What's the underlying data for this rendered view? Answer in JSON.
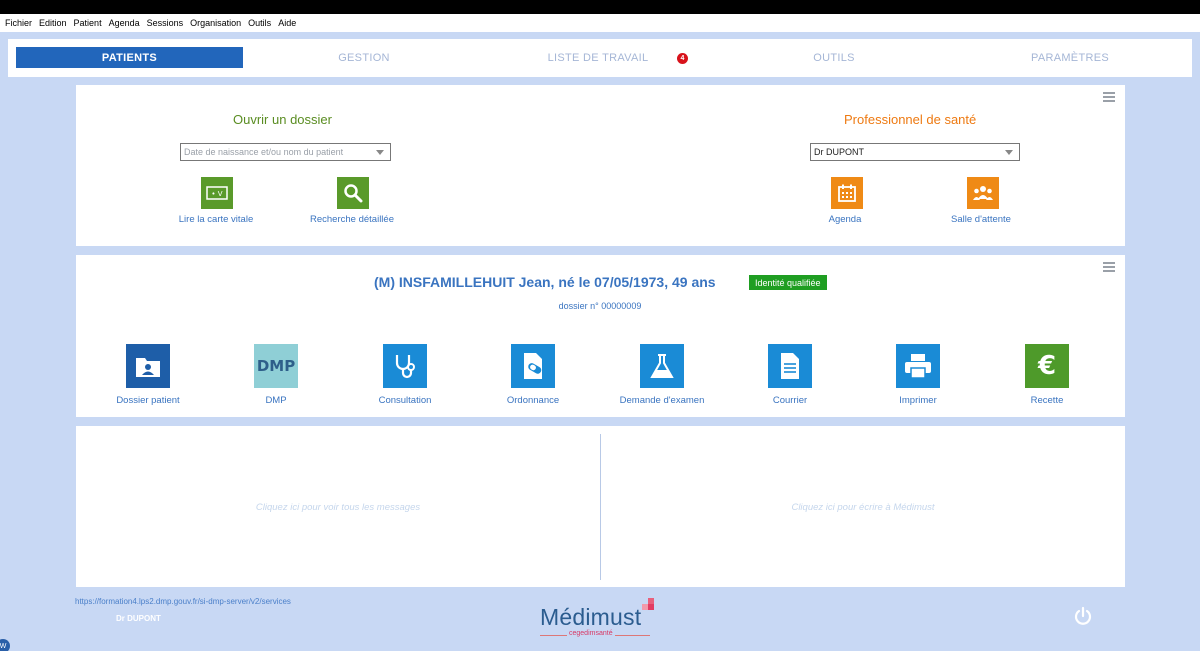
{
  "menu": [
    "Fichier",
    "Edition",
    "Patient",
    "Agenda",
    "Sessions",
    "Organisation",
    "Outils",
    "Aide"
  ],
  "tabs": [
    {
      "label": "PATIENTS",
      "active": true
    },
    {
      "label": "GESTION",
      "active": false
    },
    {
      "label": "LISTE DE TRAVAIL",
      "active": false,
      "badge": "4"
    },
    {
      "label": "OUTILS",
      "active": false
    },
    {
      "label": "PARAMÈTRES",
      "active": false
    }
  ],
  "open_file": {
    "title": "Ouvrir un dossier",
    "search_placeholder": "Date de naissance et/ou nom du patient",
    "actions": [
      {
        "label": "Lire la carte vitale",
        "icon": "vitale-card-icon"
      },
      {
        "label": "Recherche détaillée",
        "icon": "search-icon"
      }
    ]
  },
  "professional": {
    "title": "Professionnel de santé",
    "selected": "Dr DUPONT",
    "actions": [
      {
        "label": "Agenda",
        "icon": "calendar-icon"
      },
      {
        "label": "Salle d'attente",
        "icon": "waiting-room-icon"
      }
    ]
  },
  "patient": {
    "header": "(M)  INSFAMILLEHUIT Jean, né le 07/05/1973, 49 ans",
    "badge": "Identité qualifiée",
    "dossier": "dossier n° 00000009",
    "actions": [
      {
        "label": "Dossier patient",
        "icon": "patient-folder-icon"
      },
      {
        "label": "DMP",
        "icon": "dmp-icon",
        "icon_text": "DMP"
      },
      {
        "label": "Consultation",
        "icon": "stethoscope-icon"
      },
      {
        "label": "Ordonnance",
        "icon": "prescription-icon"
      },
      {
        "label": "Demande d'examen",
        "icon": "flask-icon"
      },
      {
        "label": "Courrier",
        "icon": "document-icon"
      },
      {
        "label": "Imprimer",
        "icon": "printer-icon"
      },
      {
        "label": "Recette",
        "icon": "euro-icon",
        "icon_text": "€"
      }
    ]
  },
  "messages": {
    "left": "Cliquez ici pour voir tous les messages",
    "right": "Cliquez ici pour écrire à Médimust"
  },
  "footer": {
    "url": "https://formation4.lps2.dmp.gouv.fr/si-dmp-server/v2/services",
    "user": "Dr DUPONT",
    "logo": "Médimust",
    "logo_sub": "cegedimsanté"
  },
  "colors": {
    "accent": "#2266bb",
    "green": "#5a8d22",
    "orange": "#ee7a12",
    "blue_tile": "#1a8bd6",
    "navy_tile": "#1e5ea8",
    "identity_badge": "#1f9e22",
    "badge_red": "#d8121b"
  }
}
